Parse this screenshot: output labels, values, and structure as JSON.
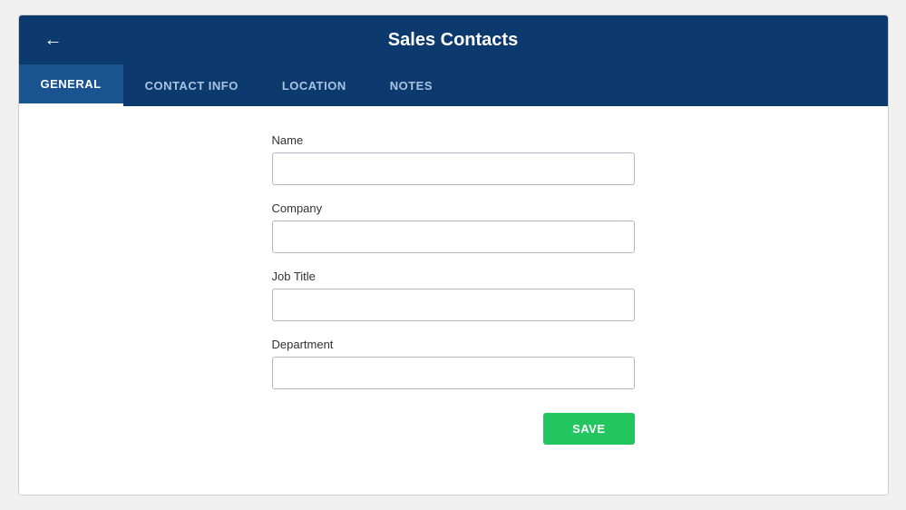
{
  "header": {
    "title": "Sales Contacts",
    "back_label": "←"
  },
  "tabs": [
    {
      "id": "general",
      "label": "GENERAL",
      "active": true
    },
    {
      "id": "contact-info",
      "label": "CONTACT INFO",
      "active": false
    },
    {
      "id": "location",
      "label": "LOCATION",
      "active": false
    },
    {
      "id": "notes",
      "label": "NOTES",
      "active": false
    }
  ],
  "form": {
    "fields": [
      {
        "id": "name",
        "label": "Name",
        "value": "",
        "placeholder": ""
      },
      {
        "id": "company",
        "label": "Company",
        "value": "",
        "placeholder": ""
      },
      {
        "id": "job-title",
        "label": "Job Title",
        "value": "",
        "placeholder": ""
      },
      {
        "id": "department",
        "label": "Department",
        "value": "",
        "placeholder": ""
      }
    ],
    "save_button_label": "SAVE"
  }
}
